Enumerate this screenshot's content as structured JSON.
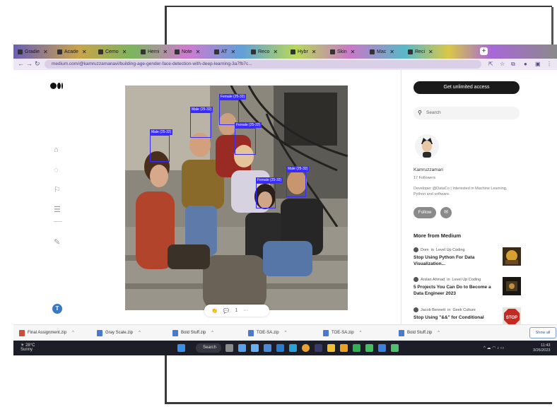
{
  "browser": {
    "tabs": [
      {
        "label": "Gradie"
      },
      {
        "label": "Acade"
      },
      {
        "label": "Cemo"
      },
      {
        "label": "Hemi"
      },
      {
        "label": "Note"
      },
      {
        "label": "AT"
      },
      {
        "label": "Reco"
      },
      {
        "label": "Hybr"
      },
      {
        "label": "Skin"
      },
      {
        "label": "Mac"
      },
      {
        "label": "Reci"
      }
    ],
    "url": "medium.com/@kamruzzamanavi/building-age-gender-face-detection-with-deep-learning-3a7fb7c...",
    "new_tab": "+"
  },
  "rail": {
    "avatar_letter": "T"
  },
  "article": {
    "detections": [
      {
        "label": "Male (25-32)"
      },
      {
        "label": "Male (25-32)"
      },
      {
        "label": "Female (25-32)"
      },
      {
        "label": "Female (25-32)"
      },
      {
        "label": "Female (25-32)"
      },
      {
        "label": "Male (25-32)"
      }
    ],
    "clap_count": "",
    "comment_count": "1"
  },
  "sidebar": {
    "get_access": "Get unlimited access",
    "search_placeholder": "Search",
    "author_name": "Kamruzzaman",
    "followers": "17 Followers",
    "bio": "Developer @DataCo | Interested in Machine Learning, Python and software.",
    "follow": "Follow",
    "more_heading": "More from Medium",
    "more": [
      {
        "author": "Dom",
        "pub": "Level Up Coding",
        "title": "Stop Using Python For Data Visualization..."
      },
      {
        "author": "Arslan Ahmad",
        "pub": "Level Up Coding",
        "title": "5 Projects You Can Do to Become a Data Engineer 2023"
      },
      {
        "author": "Jacob Bennett",
        "pub": "Geek Culture",
        "title": "Stop Using \"&&\" for Conditional"
      }
    ]
  },
  "downloads": {
    "items": [
      {
        "name": "Final Assignment.zip"
      },
      {
        "name": "Gray Scale.zip"
      },
      {
        "name": "Bold Stuff.zip"
      },
      {
        "name": "TOE-SA.zip"
      },
      {
        "name": "TOE-SA.zip"
      },
      {
        "name": "Bold Stuff.zip"
      }
    ],
    "show_all": "Show all"
  },
  "taskbar": {
    "weather_temp": "28°C",
    "weather_desc": "Sunny",
    "search": "Search",
    "time": "11:43",
    "date": "3/26/2023"
  }
}
